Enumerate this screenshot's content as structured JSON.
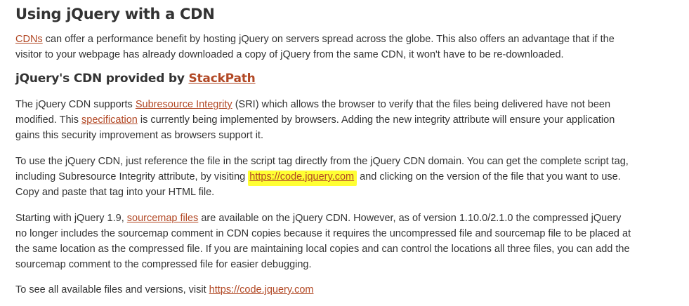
{
  "heading": "Using jQuery with a CDN",
  "p1": {
    "link": "CDNs",
    "text": " can offer a performance benefit by hosting jQuery on servers spread across the globe. This also offers an advantage that if the visitor to your webpage has already downloaded a copy of jQuery from the same CDN, it won't have to be re-downloaded."
  },
  "subheading": {
    "text": "jQuery's CDN provided by ",
    "link": "StackPath"
  },
  "p2": {
    "t1": "The jQuery CDN supports ",
    "link1": "Subresource Integrity",
    "t2": " (SRI) which allows the browser to verify that the files being delivered have not been modified. This ",
    "link2": "specification",
    "t3": " is currently being implemented by browsers. Adding the new integrity attribute will ensure your application gains this security improvement as browsers support it."
  },
  "p3": {
    "t1": "To use the jQuery CDN, just reference the file in the script tag directly from the jQuery CDN domain. You can get the complete script tag, including Subresource Integrity attribute, by visiting ",
    "link": "https://code.jquery.com",
    "t2": " and clicking on the version of the file that you want to use. Copy and paste that tag into your HTML file."
  },
  "p4": {
    "t1": "Starting with jQuery 1.9, ",
    "link": "sourcemap files",
    "t2": " are available on the jQuery CDN. However, as of version 1.10.0/2.1.0 the compressed jQuery no longer includes the sourcemap comment in CDN copies because it requires the uncompressed file and sourcemap file to be placed at the same location as the compressed file. If you are maintaining local copies and can control the locations all three files, you can add the sourcemap comment to the compressed file for easier debugging."
  },
  "p5": {
    "t1": "To see all available files and versions, visit ",
    "link": "https://code.jquery.com"
  },
  "colors": {
    "link": "#b24926",
    "text": "#333333",
    "highlight": "#ffff33"
  }
}
